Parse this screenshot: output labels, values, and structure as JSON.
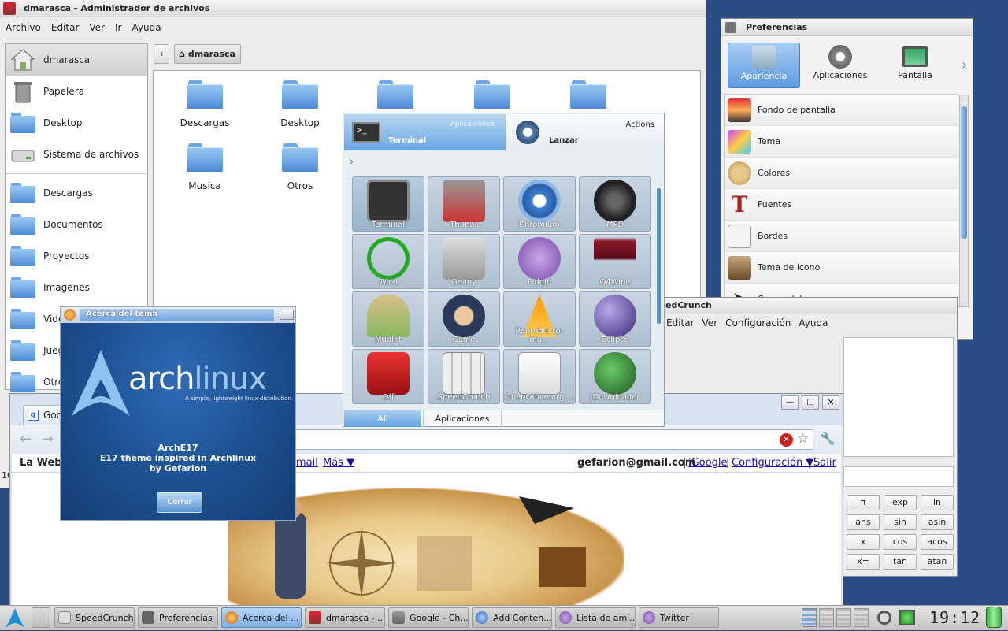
{
  "file_manager": {
    "title": "dmarasca - Administrador de archivos",
    "menu": [
      "Archivo",
      "Editar",
      "Ver",
      "Ir",
      "Ayuda"
    ],
    "location": "dmarasca",
    "sidebar_places": [
      "dmarasca",
      "Papelera",
      "Desktop",
      "Sistema de archivos"
    ],
    "sidebar_bookmarks": [
      "Descargas",
      "Documentos",
      "Proyectos",
      "Imagenes",
      "Vide",
      "Jueg",
      "Otros"
    ],
    "files": [
      "Descargas",
      "Desktop",
      "Musica",
      "Otros"
    ],
    "status_fragment": "10"
  },
  "launcher": {
    "tab_apps_header": "Aplicaciones",
    "tab_apps_selected": "Terminal",
    "tab_actions_header": "Actions",
    "tab_actions_label": "Lanzar",
    "breadcrumb": "›",
    "apps": [
      "Terminal",
      "Thunar",
      "Chromium",
      "MPD",
      "Wicd",
      "Geany",
      "Pidgin",
      "Q4Wine",
      "Mudlet",
      "Osmo",
      "Reproductor mu...",
      "Eclipse",
      "Off",
      "SpeedCrunch",
      "OpenOffice.org ...",
      "JDownloader"
    ],
    "bottom_tabs": [
      "All",
      "Aplicaciones"
    ]
  },
  "preferences": {
    "title": "Preferencias",
    "categories": [
      "Apariencia",
      "Aplicaciones",
      "Pantalla"
    ],
    "items": [
      "Fondo de pantalla",
      "Tema",
      "Colores",
      "Fuentes",
      "Bordes",
      "Tema de icono",
      "Cursor del mouse"
    ]
  },
  "speedcrunch": {
    "title_fragment": "edCrunch",
    "menu": [
      "Editar",
      "Ver",
      "Configuración",
      "Ayuda"
    ],
    "buttons": [
      "π",
      "exp",
      "ln",
      "ans",
      "sin",
      "asin",
      "x",
      "cos",
      "acos",
      "x=",
      "tan",
      "atan"
    ]
  },
  "about_dialog": {
    "title": "Acerca del tema",
    "logo_text_arch": "arch",
    "logo_text_linux": "linux",
    "tagline": "A simple, lightweight linux distribution.",
    "theme_name": "ArchE17",
    "theme_desc": "E17 theme inspired in Archlinux",
    "author": "by Gefarion",
    "close_label": "Cerrar"
  },
  "browser": {
    "tab_title": "Goo",
    "left_label": "La Web",
    "links_left": [
      "mail",
      "Más ▼"
    ],
    "user": "gefarion@gmail.com",
    "links_right": [
      "iGoogle",
      "Configuración ▼",
      "Salir"
    ],
    "sep": "|"
  },
  "taskbar": {
    "items": [
      "SpeedCrunch",
      "Preferencias",
      "Acerca del ...",
      "dmarasca - ...",
      "Google - Ch...",
      "Add  Conten...",
      "Lista de ami...",
      "Twitter"
    ],
    "clock": "19:12"
  }
}
